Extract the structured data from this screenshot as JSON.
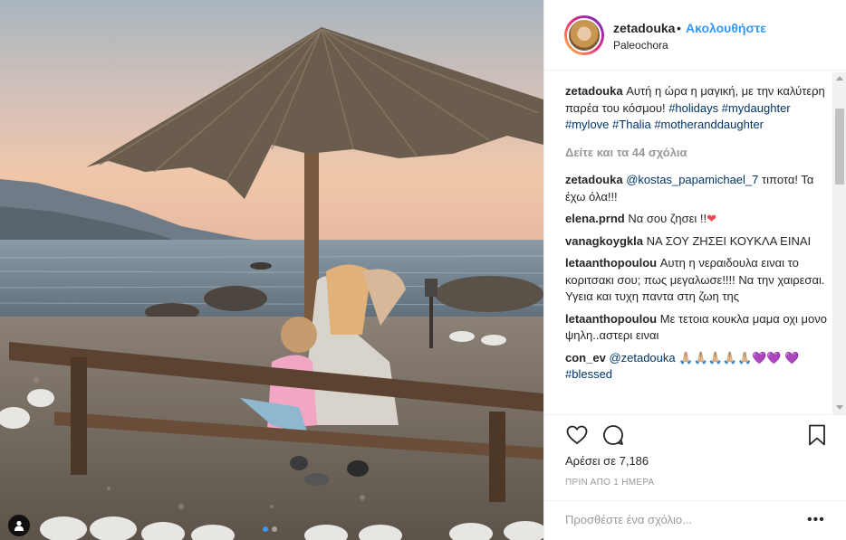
{
  "post": {
    "username": "zetadouka",
    "separator": "•",
    "follow_label": "Ακολουθήστε",
    "location": "Paleochora"
  },
  "comments": {
    "caption": {
      "user": "zetadouka",
      "text": "Αυτή η ώρα η μαγική, με την καλύτερη παρέα του κόσμου!",
      "tags": [
        "#holidays",
        "#mydaughter",
        "#mylove",
        "#Thalia",
        "#motheranddaughter"
      ]
    },
    "view_all_label": "Δείτε και τα 44 σχόλια",
    "items": [
      {
        "user": "zetadouka",
        "mention": "@kostas_papamichael_7",
        "text": "τιποτα! Τα έχω όλα!!!"
      },
      {
        "user": "elena.prnd",
        "text": "Να σου ζησει !!",
        "emoji": "❤"
      },
      {
        "user": "vanagkoygkla",
        "text": "ΝΑ ΣΟΥ ΖΗΣΕΙ ΚΟΥΚΛΑ ΕΙΝΑΙ"
      },
      {
        "user": "letaanthopoulou",
        "text": "Αυτη η νεραιδουλα ειναι το κοριτσακι σου; πως μεγαλωσε!!!! Να την χαιρεσαι. Υγεια και τυχη παντα στη ζωη της"
      },
      {
        "user": "letaanthopoulou",
        "text": "Με τετοια κουκλα μαμα οχι μονο ψηλη..αστερι ειναι"
      },
      {
        "user": "con_ev",
        "mention": "@zetadouka",
        "emoji": "🙏🏼🙏🏼🙏🏼🙏🏼🙏🏼",
        "hearts": "💜💜",
        "tag": "💜 #blessed"
      }
    ]
  },
  "stats": {
    "likes_label": "Αρέσει σε 7,186",
    "timestamp": "ΠΡΙΝ ΑΠΟ 1 ΗΜΕΡΑ"
  },
  "add_comment": {
    "placeholder": "Προσθέστε ένα σχόλιο...",
    "more": "•••"
  },
  "colors": {
    "accent": "#3897f0",
    "hashtag": "#003569",
    "muted": "#999999",
    "text": "#262626"
  },
  "icons": [
    "user-tag-icon",
    "heart-icon",
    "comment-icon",
    "bookmark-icon",
    "more-options-icon"
  ],
  "carousel": {
    "count": 2,
    "active": 1
  }
}
